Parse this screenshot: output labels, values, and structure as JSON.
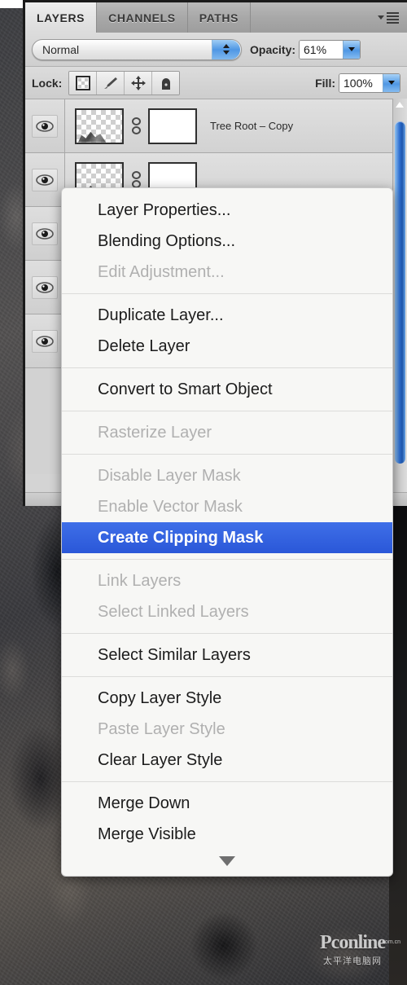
{
  "panel": {
    "tabs": [
      {
        "label": "LAYERS",
        "active": true
      },
      {
        "label": "CHANNELS",
        "active": false
      },
      {
        "label": "PATHS",
        "active": false
      }
    ],
    "panel_menu_icon": "panel-menu-icon",
    "blend_mode": {
      "value": "Normal",
      "stepper_icon": "up-down-stepper-icon"
    },
    "opacity": {
      "label": "Opacity:",
      "value": "61%"
    },
    "fill": {
      "label": "Fill:",
      "value": "100%"
    },
    "lock": {
      "label": "Lock:",
      "buttons": [
        {
          "icon": "lock-transparency-icon"
        },
        {
          "icon": "lock-image-brush-icon"
        },
        {
          "icon": "lock-position-move-icon"
        },
        {
          "icon": "lock-all-padlock-icon"
        }
      ]
    },
    "layers": [
      {
        "visible": true,
        "eye_icon": "eye-visibility-icon",
        "thumbnail": "layer-thumbnail-transparent",
        "link_icon": "link-mask-icon",
        "mask_thumbnail": "layer-mask-white",
        "name": "Tree Root – Copy"
      },
      {
        "visible": true,
        "eye_icon": "eye-visibility-icon",
        "thumbnail": "layer-thumbnail-transparent",
        "link_icon": "link-mask-icon",
        "mask_thumbnail": "layer-mask-white",
        "name": ""
      },
      {
        "visible": true,
        "eye_icon": "eye-visibility-icon",
        "thumbnail": "layer-thumbnail-transparent",
        "link_icon": "link-mask-icon",
        "mask_thumbnail": "layer-mask-white",
        "name": ""
      },
      {
        "visible": true,
        "eye_icon": "eye-visibility-icon",
        "thumbnail": "layer-thumbnail-transparent",
        "link_icon": "link-mask-icon",
        "mask_thumbnail": "layer-mask-white",
        "name": ""
      },
      {
        "visible": true,
        "eye_icon": "eye-visibility-icon",
        "thumbnail": "layer-thumbnail-transparent",
        "link_icon": "link-mask-icon",
        "mask_thumbnail": "layer-mask-white",
        "name": ""
      }
    ],
    "scrollbar": {
      "up_arrow_icon": "scroll-up-arrow-icon",
      "thumb_color": "#2f6fd0"
    }
  },
  "context_menu": {
    "highlight_color": "#2f5fe0",
    "groups": [
      {
        "items": [
          {
            "label": "Layer Properties...",
            "state": "enabled"
          },
          {
            "label": "Blending Options...",
            "state": "enabled"
          },
          {
            "label": "Edit Adjustment...",
            "state": "disabled"
          }
        ]
      },
      {
        "items": [
          {
            "label": "Duplicate Layer...",
            "state": "enabled"
          },
          {
            "label": "Delete Layer",
            "state": "enabled"
          }
        ]
      },
      {
        "items": [
          {
            "label": "Convert to Smart Object",
            "state": "enabled"
          }
        ]
      },
      {
        "items": [
          {
            "label": "Rasterize Layer",
            "state": "disabled"
          }
        ]
      },
      {
        "items": [
          {
            "label": "Disable Layer Mask",
            "state": "disabled"
          },
          {
            "label": "Enable Vector Mask",
            "state": "disabled"
          },
          {
            "label": "Create Clipping Mask",
            "state": "selected"
          }
        ]
      },
      {
        "items": [
          {
            "label": "Link Layers",
            "state": "disabled"
          },
          {
            "label": "Select Linked Layers",
            "state": "disabled"
          }
        ]
      },
      {
        "items": [
          {
            "label": "Select Similar Layers",
            "state": "enabled"
          }
        ]
      },
      {
        "items": [
          {
            "label": "Copy Layer Style",
            "state": "enabled"
          },
          {
            "label": "Paste Layer Style",
            "state": "disabled"
          },
          {
            "label": "Clear Layer Style",
            "state": "enabled"
          }
        ]
      },
      {
        "items": [
          {
            "label": "Merge Down",
            "state": "enabled"
          },
          {
            "label": "Merge Visible",
            "state": "enabled"
          }
        ]
      }
    ],
    "scroll_down_icon": "menu-scroll-down-arrow-icon"
  },
  "watermark": {
    "primary": "Pconline",
    "tld": ".com.cn",
    "secondary": "太平洋电脑网"
  }
}
